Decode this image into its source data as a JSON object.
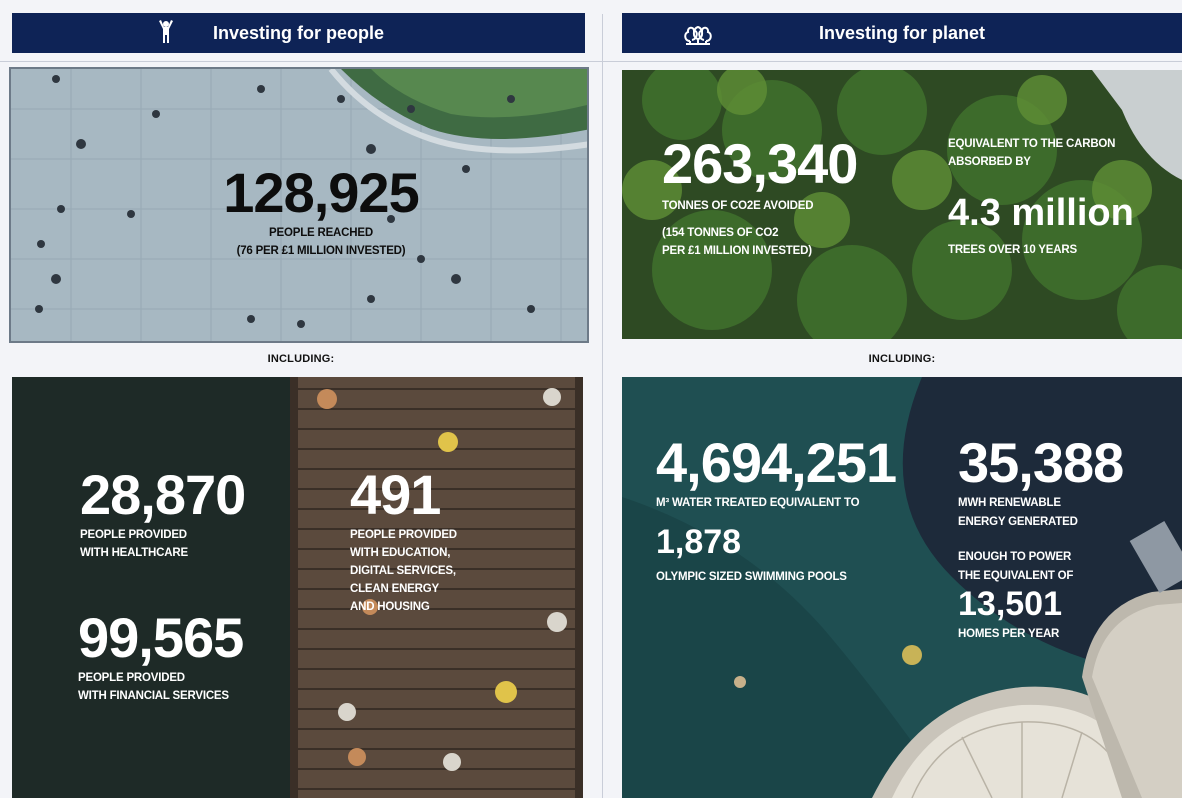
{
  "people": {
    "banner_title": "Investing for people",
    "banner_icon": "person-arms-raised-icon",
    "headline": {
      "number": "128,925",
      "label_line1": "PEOPLE REACHED",
      "label_line2": "(76 PER £1 MILLION INVESTED)"
    },
    "including_label": "INCLUDING:",
    "stats": [
      {
        "number": "28,870",
        "line1": "PEOPLE PROVIDED",
        "line2": "WITH HEALTHCARE"
      },
      {
        "number": "491",
        "line1": "PEOPLE PROVIDED",
        "line2": "WITH EDUCATION,",
        "line3": "DIGITAL SERVICES,",
        "line4": "CLEAN ENERGY",
        "line5": "AND HOUSING"
      },
      {
        "number": "99,565",
        "line1": "PEOPLE PROVIDED",
        "line2": "WITH FINANCIAL SERVICES"
      }
    ]
  },
  "planet": {
    "banner_title": "Investing for planet",
    "banner_icon": "trees-icon",
    "headline": {
      "number": "263,340",
      "label_line1": "TONNES OF CO2e AVOIDED",
      "label_line2": "(154 TONNES OF CO2",
      "label_line3": "PER £1 MILLION INVESTED)",
      "equiv_line1": "EQUIVALENT TO THE CARBON",
      "equiv_line2": "ABSORBED BY",
      "equiv_number": "4.3 million",
      "equiv_line3": "TREES OVER 10 YEARS"
    },
    "including_label": "INCLUDING:",
    "water": {
      "number": "4,694,251",
      "line1": "M³ WATER TREATED EQUIVALENT TO",
      "number2": "1,878",
      "line2": "OLYMPIC SIZED SWIMMING POOLS"
    },
    "energy": {
      "number": "35,388",
      "line1": "MWH RENEWABLE",
      "line2": "ENERGY GENERATED",
      "line3": "ENOUGH TO POWER",
      "line4": "THE EQUIVALENT OF",
      "number2": "13,501",
      "line5": "HOMES PER YEAR"
    }
  },
  "colors": {
    "banner": "#0e2356",
    "background": "#f3f4f8"
  }
}
